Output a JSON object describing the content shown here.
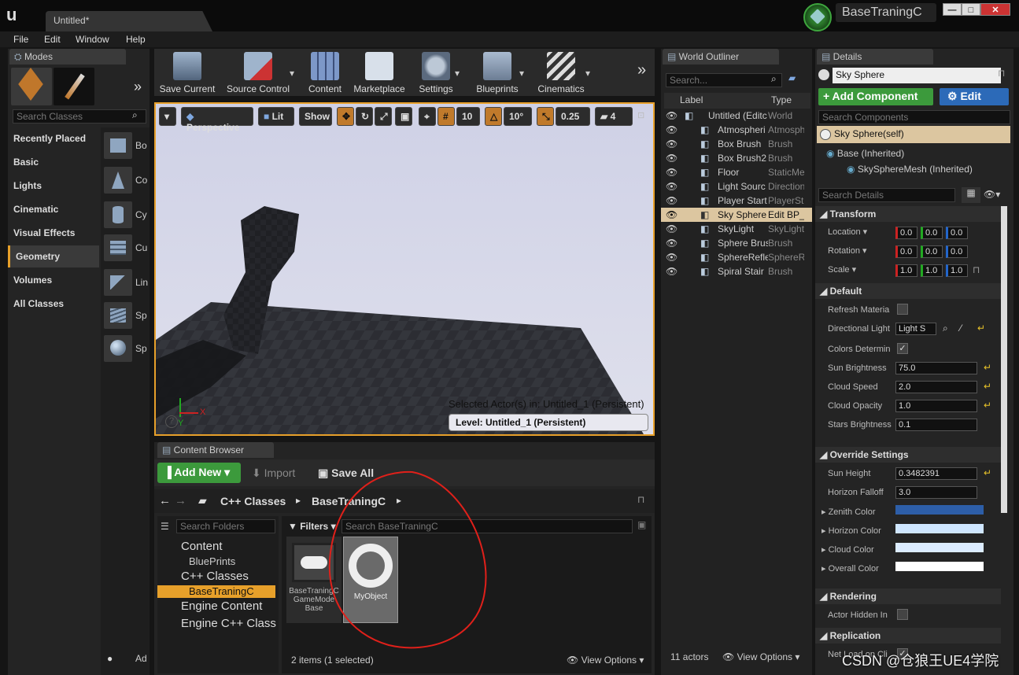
{
  "window": {
    "app_logo": "unreal-logo",
    "document_tab": "Untitled*",
    "project_name": "BaseTraningC",
    "controls": {
      "minimize": "—",
      "maximize": "□",
      "close": "✕"
    }
  },
  "menu": [
    "File",
    "Edit",
    "Window",
    "Help"
  ],
  "modes": {
    "tab_label": "Modes",
    "search_placeholder": "Search Classes",
    "categories": [
      "Recently Placed",
      "Basic",
      "Lights",
      "Cinematic",
      "Visual Effects",
      "Geometry",
      "Volumes",
      "All Classes"
    ],
    "selected_category": "Geometry",
    "primitives": [
      "Bo",
      "Co",
      "Cy",
      "Cu",
      "Lin",
      "Sp",
      "Sp"
    ],
    "bottom_label": "Ad"
  },
  "toolbar": {
    "buttons": [
      "Save Current",
      "Source Control",
      "Content",
      "Marketplace",
      "Settings",
      "Blueprints",
      "Cinematics"
    ],
    "more": "»"
  },
  "viewport": {
    "perspective": "Perspective",
    "lit": "Lit",
    "show": "Show",
    "grid_snap": "10",
    "rot_snap": "10°",
    "scale_snap": "0.25",
    "cam_speed": "4",
    "selected_actor_text": "Selected Actor(s) in:  Untitled_1 (Persistent)",
    "level_text": "Level:  Untitled_1 (Persistent)",
    "axis_x": "X",
    "axis_y": "Y"
  },
  "outliner": {
    "tab_label": "World Outliner",
    "search_placeholder": "Search...",
    "col_label": "Label",
    "col_type": "Type",
    "rows": [
      {
        "label": "Untitled (Editc",
        "type": "World"
      },
      {
        "label": "Atmospheri",
        "type": "Atmosph"
      },
      {
        "label": "Box Brush",
        "type": "Brush"
      },
      {
        "label": "Box Brush2",
        "type": "Brush"
      },
      {
        "label": "Floor",
        "type": "StaticMe"
      },
      {
        "label": "Light Sourc",
        "type": "Direction"
      },
      {
        "label": "Player Start",
        "type": "PlayerSt"
      },
      {
        "label": "Sky Sphere",
        "type": "Edit BP_"
      },
      {
        "label": "SkyLight",
        "type": "SkyLight"
      },
      {
        "label": "Sphere Brus",
        "type": "Brush"
      },
      {
        "label": "SphereRefle",
        "type": "SphereR"
      },
      {
        "label": "Spiral Stair",
        "type": "Brush"
      }
    ],
    "selected_row": "Sky Sphere",
    "count": "11 actors",
    "view_options": "View Options"
  },
  "details": {
    "tab_label": "Details",
    "actor_name": "Sky Sphere",
    "add_component": "+ Add Component",
    "edit": "Edit",
    "search_components": "Search Components",
    "self_item": "Sky Sphere(self)",
    "base_item": "Base (Inherited)",
    "mesh_item": "SkySphereMesh (Inherited)",
    "search_details": "Search Details",
    "sections": {
      "transform": "Transform",
      "default": "Default",
      "override": "Override Settings",
      "rendering": "Rendering",
      "replication": "Replication"
    },
    "transform": {
      "location_label": "Location",
      "rotation_label": "Rotation",
      "scale_label": "Scale",
      "location": [
        "0.0",
        "0.0",
        "0.0"
      ],
      "rotation": [
        "0.0",
        "0.0",
        "0.0"
      ],
      "scale": [
        "1.0",
        "1.0",
        "1.0"
      ]
    },
    "default_props": [
      {
        "label": "Refresh Materia",
        "value": ""
      },
      {
        "label": "Directional Light",
        "value": "Light S"
      },
      {
        "label": "Colors Determin",
        "value": ""
      },
      {
        "label": "Sun Brightness",
        "value": "75.0"
      },
      {
        "label": "Cloud Speed",
        "value": "2.0"
      },
      {
        "label": "Cloud Opacity",
        "value": "1.0"
      },
      {
        "label": "Stars Brightness",
        "value": "0.1"
      }
    ],
    "override_props": [
      {
        "label": "Sun Height",
        "value": "0.3482391"
      },
      {
        "label": "Horizon Falloff",
        "value": "3.0"
      },
      {
        "label": "Zenith Color",
        "color": "#2d5ea8"
      },
      {
        "label": "Horizon Color",
        "color": "#cfe6ff"
      },
      {
        "label": "Cloud Color",
        "color": "#dcecff"
      },
      {
        "label": "Overall Color",
        "color": "#ffffff"
      }
    ],
    "rendering_prop": "Actor Hidden In",
    "replication_prop": "Net Load on Cli"
  },
  "content_browser": {
    "tab_label": "Content Browser",
    "add_new": "Add New",
    "import": "Import",
    "save_all": "Save All",
    "path": [
      "C++ Classes",
      "BaseTraningC"
    ],
    "search_folders": "Search Folders",
    "filters": "Filters",
    "search_assets": "Search BaseTraningC",
    "folders": [
      {
        "label": "Content",
        "level": 0
      },
      {
        "label": "BluePrints",
        "level": 1
      },
      {
        "label": "C++ Classes",
        "level": 0
      },
      {
        "label": "BaseTraningC",
        "level": 1
      },
      {
        "label": "Engine Content",
        "level": 0
      },
      {
        "label": "Engine C++ Class",
        "level": 0
      }
    ],
    "assets": [
      {
        "label": "BaseTraningC GameMode Base"
      },
      {
        "label": "MyObject"
      }
    ],
    "status": "2 items (1 selected)",
    "view_options": "View Options"
  },
  "watermark": "CSDN @仓狼王UE4学院"
}
